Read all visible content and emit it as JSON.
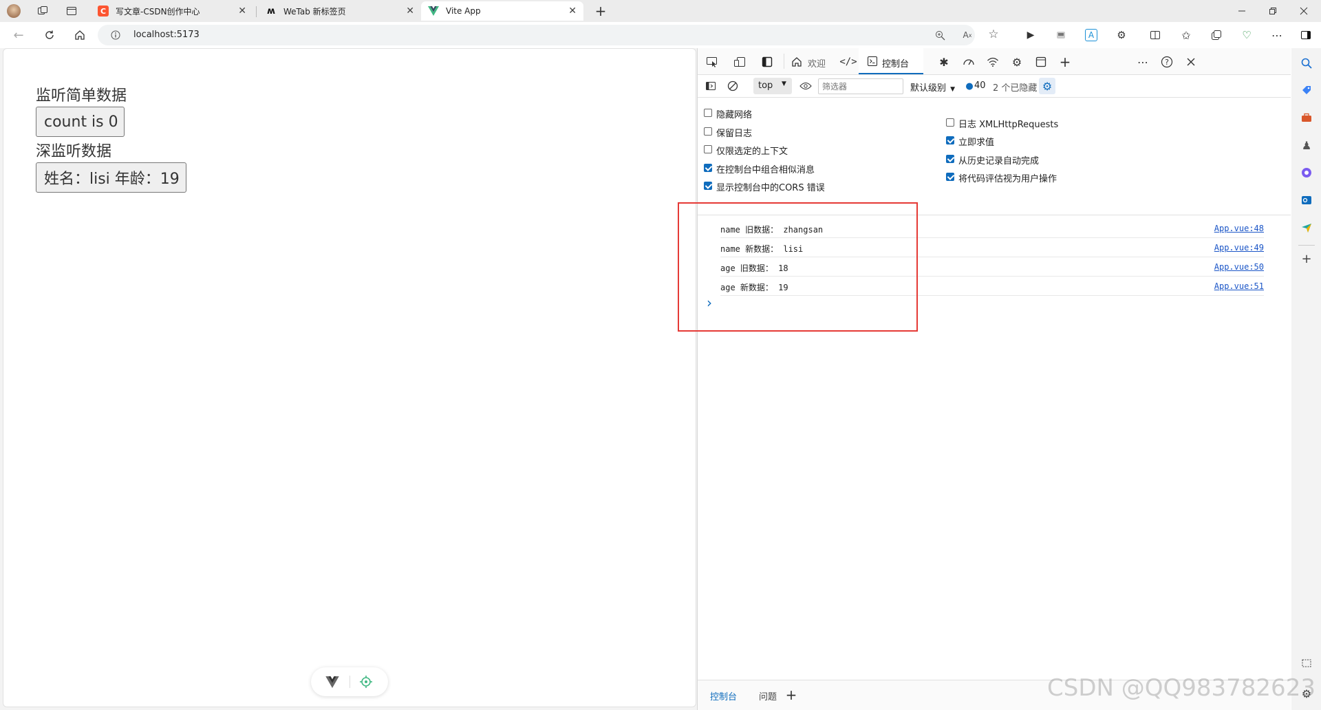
{
  "tabs": [
    {
      "label": "写文章-CSDN创作中心",
      "favicon": "C",
      "favicon_color": "#fc5531"
    },
    {
      "label": "WeTab 新标签页",
      "favicon": "W",
      "favicon_color": "#111111"
    },
    {
      "label": "Vite App",
      "favicon": "V",
      "favicon_color": "#41b883",
      "active": true
    }
  ],
  "address": {
    "url": "localhost:5173"
  },
  "page": {
    "heading_simple": "监听简单数据",
    "count_button": "count is 0",
    "heading_deep": "深监听数据",
    "person_button": "姓名：lisi 年龄：19"
  },
  "devtools": {
    "top_tabs": {
      "welcome": "欢迎",
      "console": "控制台"
    },
    "toolbar": {
      "context": "top",
      "filter_placeholder": "筛选器",
      "level": "默认级别",
      "message_count": "40",
      "hidden": "2 个已隐藏"
    },
    "settings_left": [
      {
        "label": "隐藏网络",
        "checked": false
      },
      {
        "label": "保留日志",
        "checked": false
      },
      {
        "label": "仅限选定的上下文",
        "checked": false
      },
      {
        "label": "在控制台中组合相似消息",
        "checked": true
      },
      {
        "label": "显示控制台中的CORS 错误",
        "checked": true
      }
    ],
    "settings_right": [
      {
        "label": "日志 XMLHttpRequests",
        "checked": false
      },
      {
        "label": "立即求值",
        "checked": true
      },
      {
        "label": "从历史记录自动完成",
        "checked": true
      },
      {
        "label": "将代码评估视为用户操作",
        "checked": true
      }
    ],
    "logs": [
      {
        "message": "name 旧数据： zhangsan",
        "source": "App.vue:48"
      },
      {
        "message": "name 新数据： lisi",
        "source": "App.vue:49"
      },
      {
        "message": "age 旧数据： 18",
        "source": "App.vue:50"
      },
      {
        "message": "age 新数据： 19",
        "source": "App.vue:51"
      }
    ],
    "prompt": "›",
    "drawer_tabs": {
      "console": "控制台",
      "issues": "问题"
    }
  },
  "watermark": "CSDN @QQ983782623",
  "colors": {
    "accent": "#0f6cbd",
    "highlight_box": "#e53935",
    "link": "#1a55c7"
  }
}
